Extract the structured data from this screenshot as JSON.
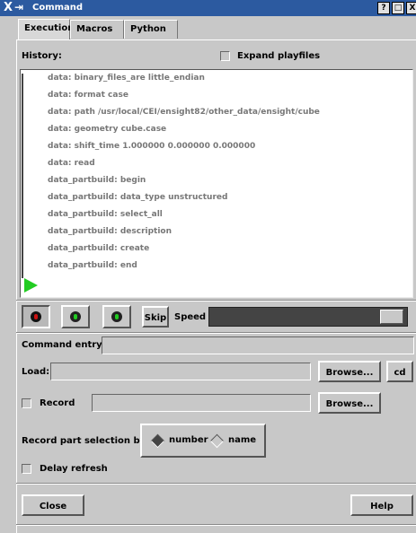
{
  "window": {
    "title": "Command"
  },
  "titlebar_buttons": [
    "?",
    "□",
    "X"
  ],
  "tabs": [
    {
      "label": "Execution",
      "active": true
    },
    {
      "label": "Macros",
      "active": false
    },
    {
      "label": "Python",
      "active": false
    }
  ],
  "history": {
    "label": "History:",
    "expand_label": "Expand playfiles",
    "lines": [
      "data: binary_files_are little_endian",
      "data: format case",
      "data: path /usr/local/CEI/ensight82/other_data/ensight/cube",
      "data: geometry cube.case",
      "data: shift_time 1.000000 0.000000 0.000000",
      "data: read",
      "data_partbuild: begin",
      "data_partbuild: data_type unstructured",
      "data_partbuild: select_all",
      "data_partbuild: description",
      "data_partbuild: create",
      "data_partbuild: end"
    ]
  },
  "controls": {
    "record_icon": "record-icon",
    "play_icon": "play-icon",
    "step_icon": "step-icon",
    "skip_label": "Skip",
    "speed_label": "Speed"
  },
  "command_entry": {
    "label": "Command entry:",
    "value": ""
  },
  "load": {
    "label": "Load:",
    "value": "",
    "browse_label": "Browse...",
    "cd_label": "cd"
  },
  "record": {
    "label": "Record",
    "value": "",
    "browse_label": "Browse..."
  },
  "record_part_selection": {
    "label": "Record part selection by:",
    "options": [
      "number",
      "name"
    ],
    "selected": "number"
  },
  "delay_refresh": {
    "label": "Delay refresh"
  },
  "footer": {
    "close_label": "Close",
    "help_label": "Help"
  },
  "colors": {
    "titlebar": "#2c5aa0",
    "panel": "#c8c8c8",
    "play_green": "#22cc22",
    "record_red": "#cc1111"
  }
}
